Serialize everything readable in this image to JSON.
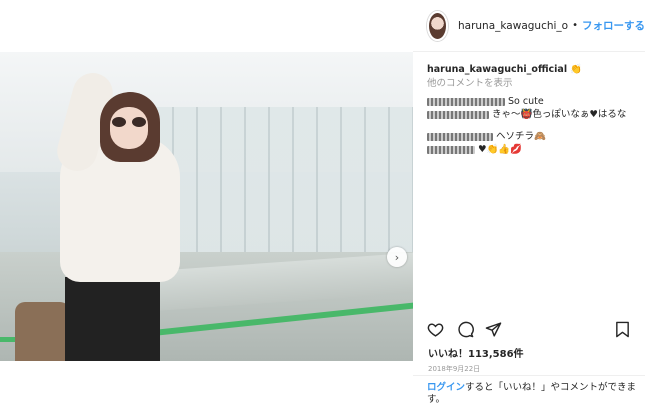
{
  "header": {
    "username": "haruna_kawaguchi_o",
    "separator": "•",
    "follow_label": "フォローする"
  },
  "caption": {
    "username": "haruna_kawaguchi_official",
    "text": "👏",
    "view_all": "他のコメントを表示"
  },
  "comments": [
    {
      "text": "So cute"
    },
    {
      "text": "きゃ〜👹色っぽいなぁ♥はるな"
    },
    {
      "text": "ヘソチラ🙈"
    },
    {
      "text": "♥👏👍💋"
    }
  ],
  "actions": {
    "like_icon": "heart-outline-icon",
    "comment_icon": "comment-bubble-icon",
    "share_icon": "paper-plane-icon",
    "save_icon": "bookmark-icon"
  },
  "likes": "いいね！113,586件",
  "date": "2018年9月22日",
  "footer": {
    "login_label": "ログイン",
    "text": "すると「いいね！」やコメントができます。"
  },
  "photo": {
    "next_arrow": "›"
  },
  "colors": {
    "link": "#3897f0",
    "text": "#262626",
    "muted": "#999999"
  }
}
